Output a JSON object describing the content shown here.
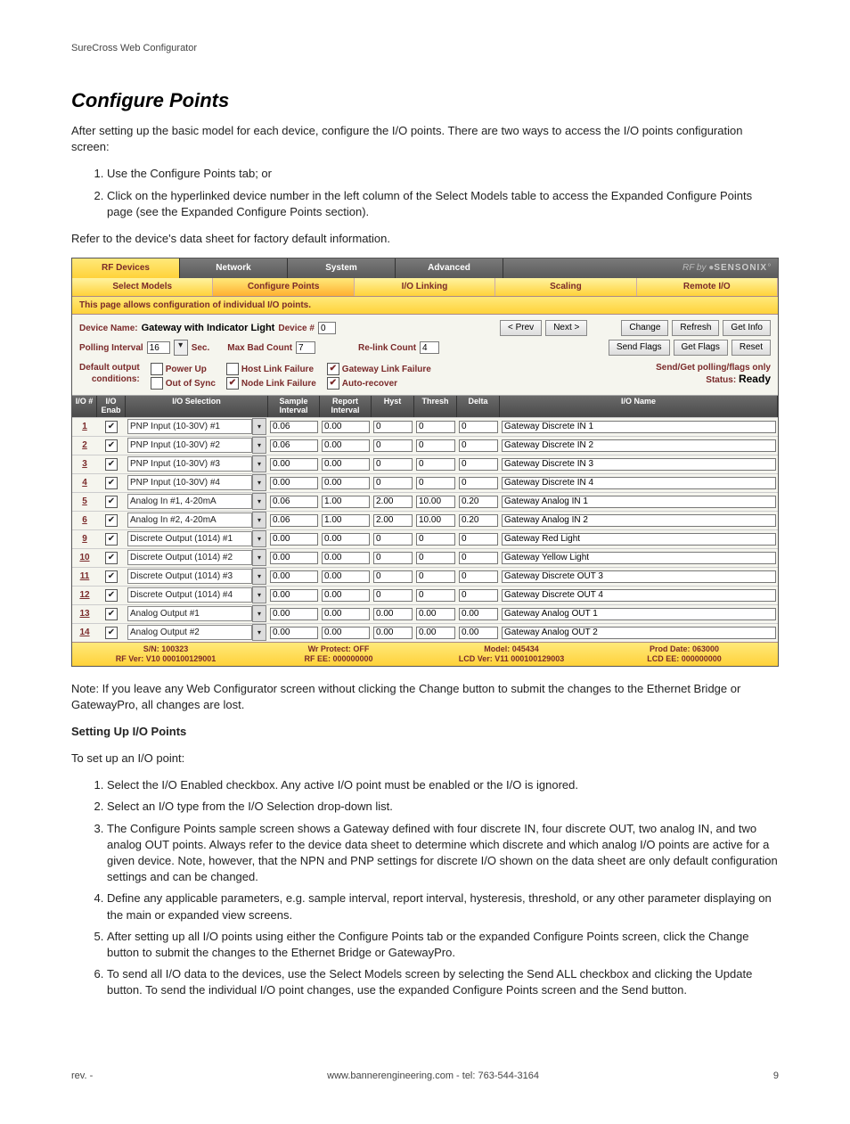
{
  "header": "SureCross Web Configurator",
  "title": "Configure Points",
  "intro": "After setting up the basic model for each device, configure the I/O points. There are two ways to access the I/O points configuration screen:",
  "intro_list": [
    "Use the Configure Points tab; or",
    "Click on the hyperlinked device number in the left column of the Select Models table to access the Expanded Configure Points page (see the Expanded Configure Points section)."
  ],
  "refer": "Refer to the device's data sheet for factory default information.",
  "shot": {
    "tabs1": [
      "RF Devices",
      "Network",
      "System",
      "Advanced"
    ],
    "brand_prefix": "RF by ",
    "brand": "SENSONIX",
    "tabs2": [
      "Select Models",
      "Configure Points",
      "I/O Linking",
      "Scaling",
      "Remote I/O"
    ],
    "infobar": "This page allows configuration of individual I/O points.",
    "device_name_label": "Device Name:",
    "device_name": "Gateway with Indicator Light",
    "device_no_label": "Device #",
    "device_no": "0",
    "prev": "< Prev",
    "next": "Next >",
    "change": "Change",
    "refresh": "Refresh",
    "getinfo": "Get Info",
    "poll_label": "Polling Interval",
    "poll_val": "16",
    "sec": "Sec.",
    "maxbad_label": "Max Bad Count",
    "maxbad_val": "7",
    "relink_label": "Re-link Count",
    "relink_val": "4",
    "sendflags": "Send Flags",
    "getflags": "Get Flags",
    "reset": "Reset",
    "cond_label1": "Default output",
    "cond_label2": "conditions:",
    "cond": [
      "Power Up",
      "Out of Sync",
      "Host Link Failure",
      "Node Link Failure",
      "Gateway Link Failure",
      "Auto-recover"
    ],
    "cond_checked": [
      false,
      false,
      false,
      false,
      true,
      true
    ],
    "sendget": "Send/Get polling/flags only",
    "status_label": "Status:",
    "status": "Ready",
    "headers": [
      "I/O #",
      "I/O Enab",
      "I/O Selection",
      "Sample Interval",
      "Report Interval",
      "Hyst",
      "Thresh",
      "Delta",
      "I/O Name"
    ],
    "rows": [
      {
        "n": "1",
        "sel": "PNP Input (10-30V) #1",
        "si": "0.06",
        "ri": "0.00",
        "h": "0",
        "t": "0",
        "d": "0",
        "name": "Gateway Discrete IN 1"
      },
      {
        "n": "2",
        "sel": "PNP Input (10-30V) #2",
        "si": "0.06",
        "ri": "0.00",
        "h": "0",
        "t": "0",
        "d": "0",
        "name": "Gateway Discrete IN 2"
      },
      {
        "n": "3",
        "sel": "PNP Input (10-30V) #3",
        "si": "0.00",
        "ri": "0.00",
        "h": "0",
        "t": "0",
        "d": "0",
        "name": "Gateway Discrete IN 3"
      },
      {
        "n": "4",
        "sel": "PNP Input (10-30V) #4",
        "si": "0.00",
        "ri": "0.00",
        "h": "0",
        "t": "0",
        "d": "0",
        "name": "Gateway Discrete IN 4"
      },
      {
        "n": "5",
        "sel": "Analog In #1, 4-20mA",
        "si": "0.06",
        "ri": "1.00",
        "h": "2.00",
        "t": "10.00",
        "d": "0.20",
        "name": "Gateway Analog IN 1"
      },
      {
        "n": "6",
        "sel": "Analog In #2, 4-20mA",
        "si": "0.06",
        "ri": "1.00",
        "h": "2.00",
        "t": "10.00",
        "d": "0.20",
        "name": "Gateway Analog IN 2"
      },
      {
        "n": "9",
        "sel": "Discrete Output (1014) #1",
        "si": "0.00",
        "ri": "0.00",
        "h": "0",
        "t": "0",
        "d": "0",
        "name": "Gateway Red Light"
      },
      {
        "n": "10",
        "sel": "Discrete Output (1014) #2",
        "si": "0.00",
        "ri": "0.00",
        "h": "0",
        "t": "0",
        "d": "0",
        "name": "Gateway Yellow Light"
      },
      {
        "n": "11",
        "sel": "Discrete Output (1014) #3",
        "si": "0.00",
        "ri": "0.00",
        "h": "0",
        "t": "0",
        "d": "0",
        "name": "Gateway Discrete OUT 3"
      },
      {
        "n": "12",
        "sel": "Discrete Output (1014) #4",
        "si": "0.00",
        "ri": "0.00",
        "h": "0",
        "t": "0",
        "d": "0",
        "name": "Gateway Discrete OUT 4"
      },
      {
        "n": "13",
        "sel": "Analog Output #1",
        "si": "0.00",
        "ri": "0.00",
        "h": "0.00",
        "t": "0.00",
        "d": "0.00",
        "name": "Gateway Analog OUT 1"
      },
      {
        "n": "14",
        "sel": "Analog Output #2",
        "si": "0.00",
        "ri": "0.00",
        "h": "0.00",
        "t": "0.00",
        "d": "0.00",
        "name": "Gateway Analog OUT 2"
      }
    ],
    "foot": {
      "sn": "S/N: 100323",
      "rfver": "RF Ver: V10 000100129001",
      "wr": "Wr Protect: OFF",
      "rfee": "RF EE: 000000000",
      "model": "Model: 045434",
      "lcdver": "LCD Ver: V11 000100129003",
      "prod": "Prod Date: 063000",
      "lcdee": "LCD EE: 000000000"
    }
  },
  "note": "Note: If you leave any Web Configurator screen without clicking the Change button to submit the changes to the Ethernet Bridge or GatewayPro, all changes are lost.",
  "setup_heading": "Setting Up I/O Points",
  "setup_intro": "To set up an I/O point:",
  "setup_list": [
    "Select the I/O Enabled checkbox. Any active I/O point must be enabled or the I/O is ignored.",
    "Select an I/O type from the I/O Selection drop-down list.",
    "The Configure Points sample screen shows a Gateway defined with four discrete IN, four discrete OUT, two analog IN, and two analog OUT points. Always refer to the device data sheet to determine which discrete and which analog I/O points are active for a given device. Note, however, that the NPN and PNP settings for discrete I/O shown on the data sheet are only default configuration settings and can be changed.",
    "Define any applicable parameters, e.g. sample interval, report interval, hysteresis, threshold, or any other parameter displaying on the main or expanded view screens.",
    "After setting up all I/O points using either the Configure Points tab or the expanded Configure Points screen, click the Change button to submit the changes to the Ethernet Bridge or GatewayPro.",
    "To send all I/O data to the devices, use the Select Models screen by selecting the Send ALL checkbox and clicking the Update button. To send the individual I/O point changes, use the expanded Configure Points screen and the Send button."
  ],
  "footer": {
    "rev": "rev. -",
    "site": "www.bannerengineering.com - tel: 763-544-3164",
    "page": "9"
  }
}
